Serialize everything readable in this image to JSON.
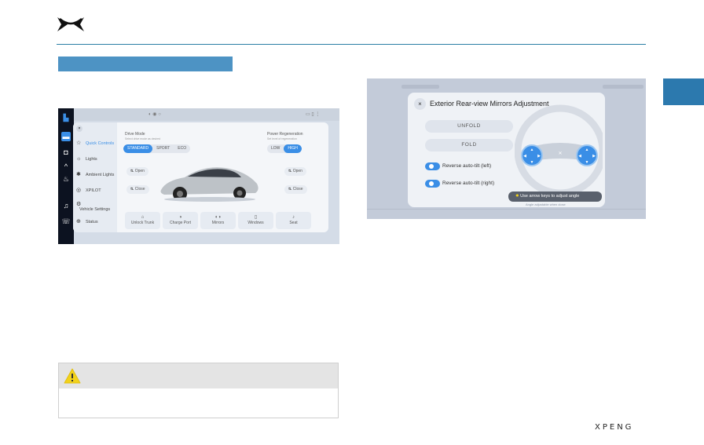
{
  "screen1": {
    "menu": [
      {
        "icon": "car-icon",
        "label": "Quick Controls",
        "active": true
      },
      {
        "icon": "light-icon",
        "label": "Lights",
        "active": false
      },
      {
        "icon": "ambient-light-icon",
        "label": "Ambient Lights",
        "active": false
      },
      {
        "icon": "xpilot-icon",
        "label": "XPILOT",
        "active": false
      },
      {
        "icon": "settings-icon",
        "label": "Vehicle Settings",
        "active": false
      },
      {
        "icon": "status-icon",
        "label": "Status",
        "active": false
      }
    ],
    "drive_mode": {
      "title": "Drive Mode",
      "subtitle": "Select drive mode as desired",
      "options": [
        "STANDARD",
        "SPORT",
        "ECO"
      ],
      "selected": "STANDARD"
    },
    "regen": {
      "title": "Power Regeneration",
      "subtitle": "Set level of regeneration",
      "options": [
        "LOW",
        "HIGH"
      ],
      "selected": "HIGH"
    },
    "buttons": {
      "front_open": "Open",
      "front_close": "Close",
      "rear_open": "Open",
      "rear_close": "Close"
    },
    "tiles": [
      "Unlock Trunk",
      "Charge Port",
      "Mirrors",
      "Windows",
      "Seat"
    ]
  },
  "screen2": {
    "title": "Exterior Rear-view Mirrors Adjustment",
    "unfold_label": "UNFOLD",
    "fold_label": "FOLD",
    "toggle_left": "Reverse auto-tilt (left)",
    "toggle_right": "Reverse auto-tilt (right)",
    "hint": "Use arrow keys to adjust angle",
    "subhint": "Angle adjustable when close"
  },
  "brand": "XPENG",
  "colors": {
    "accent": "#3a8ee6",
    "section_bar": "#4d93c4",
    "side_tab": "#2c79ae",
    "rule": "#2a7fa4",
    "warning": "#f2d21b"
  }
}
